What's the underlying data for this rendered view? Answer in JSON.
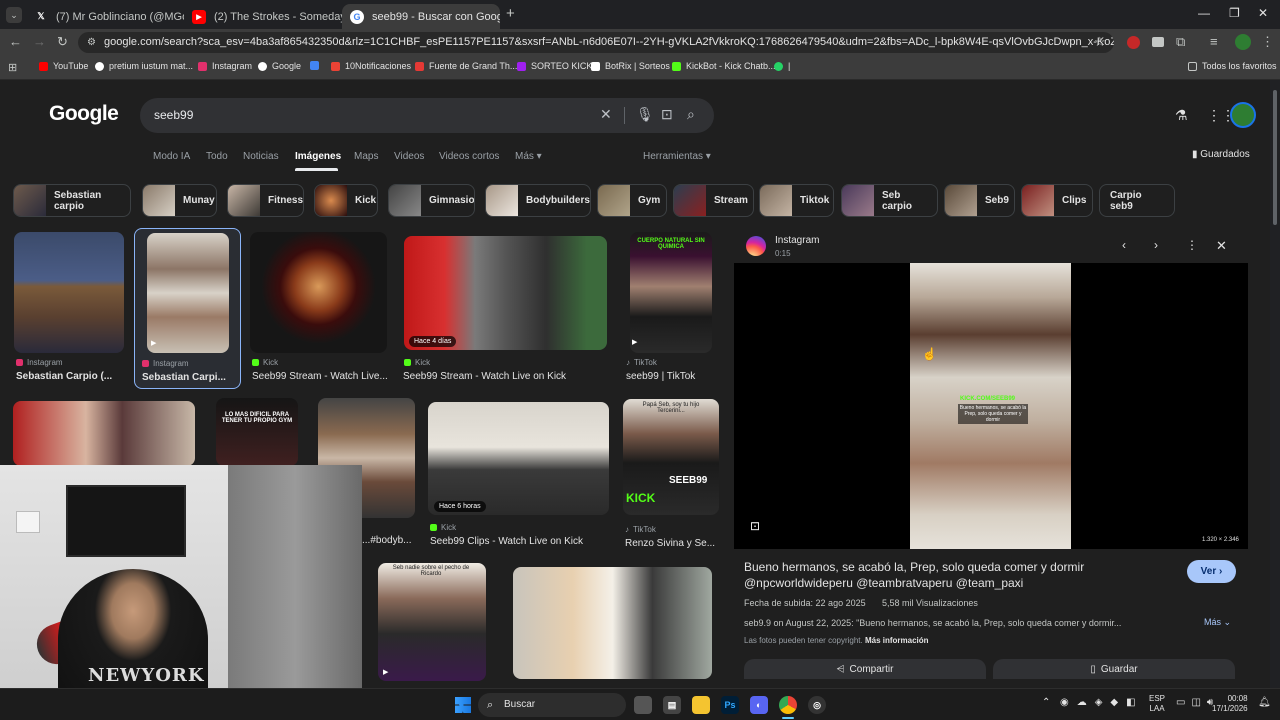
{
  "tabs": [
    {
      "label": "(7) Mr Goblinciano (@MGoblinc",
      "icon": "x-icon"
    },
    {
      "label": "(2) The Strokes - Someday (Offi",
      "icon": "youtube-icon"
    },
    {
      "label": "seeb99 - Buscar con Google",
      "icon": "google-icon"
    }
  ],
  "new_tab": "+",
  "url": "google.com/search?sca_esv=4ba3af865432350d&rlz=1C1CHBF_esPE1157PE1157&sxsrf=ANbL-n6d06E07I--2YH-gVKLA2fVkkroKQ:1768626479540&udm=2&fbs=ADc_l-bpk8W4E-qsVlOvbGJcDwpn_x-KoZgS_dIzvUJcCpPvNisF2DcSRPJfBf...",
  "bookmarks": [
    {
      "label": "YouTube",
      "color": "#ff0000"
    },
    {
      "label": "pretium iustum mat...",
      "color": "#ffffff"
    },
    {
      "label": "Instagram",
      "color": "#e1306c"
    },
    {
      "label": "Google",
      "color": "#ffffff"
    },
    {
      "label": "",
      "color": "#4285f4"
    },
    {
      "label": "10Notificaciones",
      "color": "#ea4335"
    },
    {
      "label": "Fuente de Grand Th...",
      "color": "#e53935"
    },
    {
      "label": "SORTEO KICK",
      "color": "#a020f0"
    },
    {
      "label": "BotRix | Sorteos",
      "color": "#ffffff"
    },
    {
      "label": "KickBot - Kick Chatb...",
      "color": "#53fc18"
    },
    {
      "label": "|",
      "color": "#25d366"
    }
  ],
  "all_favorites": "Todos los favoritos",
  "search": {
    "query": "seeb99"
  },
  "logo": "Google",
  "nav": [
    "Modo IA",
    "Todo",
    "Noticias",
    "Imágenes",
    "Maps",
    "Videos",
    "Videos cortos",
    "Más ▾"
  ],
  "tools": "Herramientas ▾",
  "saved": "Guardados",
  "chips": [
    "Sebastian carpio",
    "Munay",
    "Fitness",
    "Kick",
    "Gimnasio",
    "Bodybuilders",
    "Gym",
    "Stream",
    "Tiktok",
    "Seb carpio",
    "Seb9",
    "Clips",
    "Carpio seb9"
  ],
  "row1": [
    {
      "source": "Instagram",
      "title": "Sebastian Carpio (...",
      "badge": ""
    },
    {
      "source": "Instagram",
      "title": "Sebastian Carpi...",
      "badge": ""
    },
    {
      "source": "Kick",
      "title": "Seeb99 Stream - Watch Live...",
      "badge": ""
    },
    {
      "source": "Kick",
      "title": "Seeb99 Stream - Watch Live on Kick",
      "badge": "Hace 4 días"
    },
    {
      "source": "TikTok",
      "title": "seeb99 | TikTok",
      "badge": ""
    }
  ],
  "row2": [
    {
      "source": "",
      "title": "",
      "badge": ""
    },
    {
      "source": "",
      "title": "",
      "badge": ""
    },
    {
      "source": "...m",
      "title": "...#bodyb...",
      "badge": ""
    },
    {
      "source": "Kick",
      "title": "Seeb99 Clips - Watch Live on Kick",
      "badge": "Hace 6 horas"
    },
    {
      "source": "TikTok",
      "title": "Renzo Sivina y Se...",
      "badge": ""
    }
  ],
  "overlay_texts": {
    "cuerpo": "CUERPO NATURAL SIN QUIMICA",
    "gym": "LO MAS DIFICIL PARA TENER TU PROPIO GYM",
    "papa": "Papá Seb, soy tu hijo Tercerini...",
    "seeb99": "SEEB99",
    "kick": "KICK",
    "ricardo": "Seb nadie sobre el pecho de Ricardo"
  },
  "panel": {
    "source": "Instagram",
    "duration": "0:15",
    "dims": "1.320 × 2.346",
    "title": "Bueno hermanos, se acabó la, Prep, solo queda comer y dormir @npcworldwideperu @teambratvaperu @team_paxi",
    "ver": "Ver ›",
    "upload": "Fecha de subida: 22 ago 2025",
    "views": "5,58 mil Visualizaciones",
    "desc": "seb9.9 on August 22, 2025: \"Bueno hermanos, se acabó la, Prep, solo queda comer y dormir...",
    "mas": "Más ⌄",
    "copyright": "Las fotos pueden tener copyright.",
    "more_info": "Más información",
    "share": "Compartir",
    "save": "Guardar",
    "video_caption": "Bueno hermanos, se acabó la Prep, solo queda comer y dormir",
    "kick_overlay": "KICK.COM/SEEB99"
  },
  "taskbar": {
    "search": "Buscar",
    "lang": "ESP",
    "lang2": "LAA",
    "time": "00:08",
    "date": "17/1/2026"
  },
  "webcam_shirt": "NEWYORK"
}
